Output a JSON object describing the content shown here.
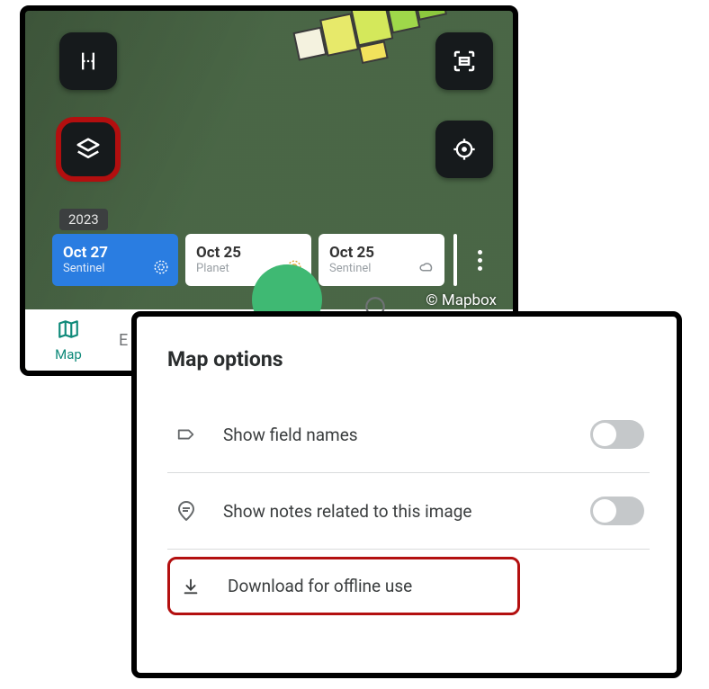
{
  "map": {
    "year_badge": "2023",
    "attribution": "© Mapbox",
    "dates": [
      {
        "date": "Oct 27",
        "source": "Sentinel",
        "weather": "sunny",
        "selected": true
      },
      {
        "date": "Oct 25",
        "source": "Planet",
        "weather": "sunny",
        "selected": false
      },
      {
        "date": "Oct 25",
        "source": "Sentinel",
        "weather": "cloudy",
        "selected": false
      }
    ],
    "nav": {
      "map_label": "Map",
      "cut_label": "E"
    }
  },
  "options": {
    "title": "Map options",
    "rows": [
      {
        "icon": "tag",
        "label": "Show field names",
        "control": "toggle"
      },
      {
        "icon": "note",
        "label": "Show notes related to this image",
        "control": "toggle"
      },
      {
        "icon": "download",
        "label": "Download for offline use",
        "control": "none",
        "highlighted": true
      }
    ]
  }
}
